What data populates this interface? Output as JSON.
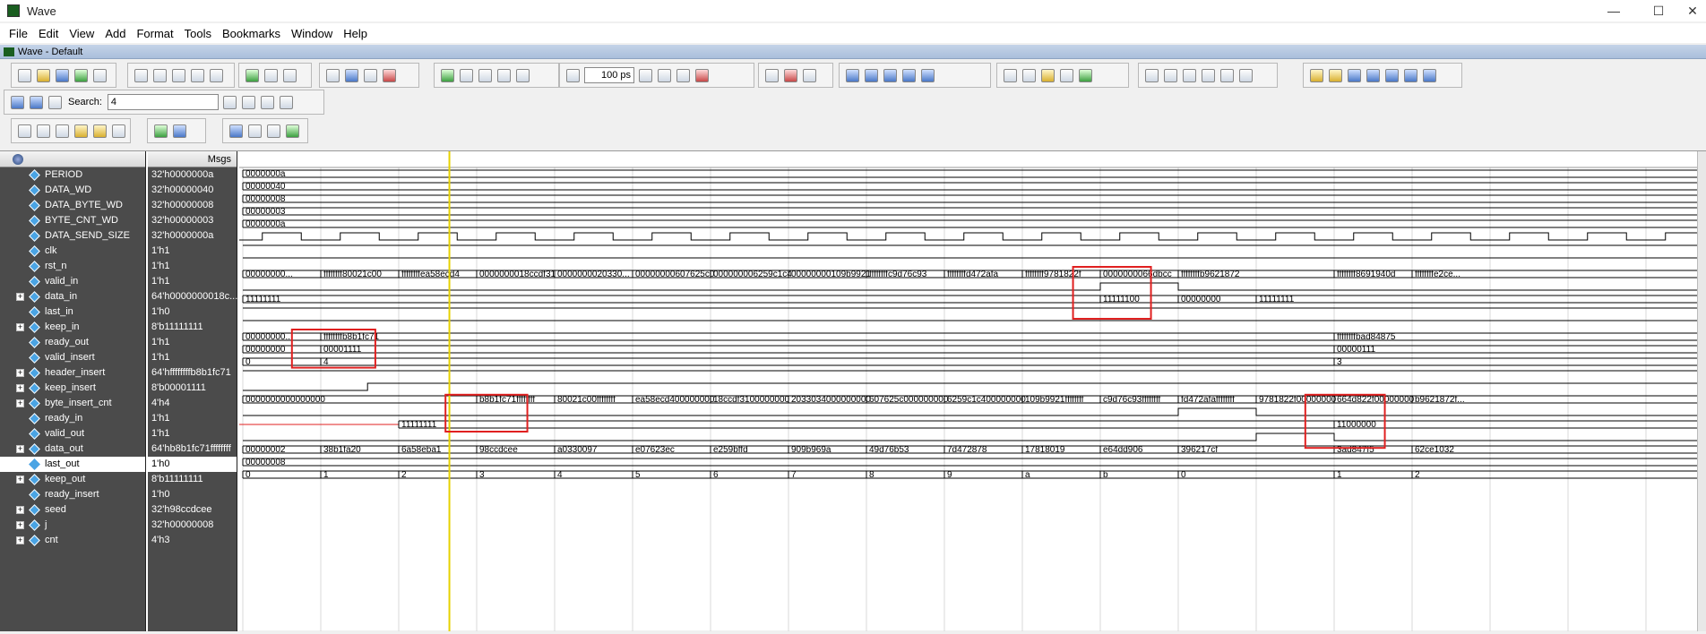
{
  "window": {
    "title": "Wave",
    "subtitle": "Wave - Default"
  },
  "menu": [
    "File",
    "Edit",
    "View",
    "Add",
    "Format",
    "Tools",
    "Bookmarks",
    "Window",
    "Help"
  ],
  "toolbar": {
    "search_label": "Search:",
    "search_value": "4",
    "time_value": "100 ps"
  },
  "header": {
    "msgs": "Msgs"
  },
  "signals": [
    {
      "name": "PERIOD",
      "value": "32'h0000000a",
      "exp": false
    },
    {
      "name": "DATA_WD",
      "value": "32'h00000040",
      "exp": false
    },
    {
      "name": "DATA_BYTE_WD",
      "value": "32'h00000008",
      "exp": false
    },
    {
      "name": "BYTE_CNT_WD",
      "value": "32'h00000003",
      "exp": false
    },
    {
      "name": "DATA_SEND_SIZE",
      "value": "32'h0000000a",
      "exp": false
    },
    {
      "name": "clk",
      "value": "1'h1",
      "exp": false
    },
    {
      "name": "rst_n",
      "value": "1'h1",
      "exp": false
    },
    {
      "name": "valid_in",
      "value": "1'h1",
      "exp": false
    },
    {
      "name": "data_in",
      "value": "64'h0000000018c...",
      "exp": true
    },
    {
      "name": "last_in",
      "value": "1'h0",
      "exp": false
    },
    {
      "name": "keep_in",
      "value": "8'b11111111",
      "exp": true
    },
    {
      "name": "ready_out",
      "value": "1'h1",
      "exp": false
    },
    {
      "name": "valid_insert",
      "value": "1'h1",
      "exp": false
    },
    {
      "name": "header_insert",
      "value": "64'hffffffffb8b1fc71",
      "exp": true
    },
    {
      "name": "keep_insert",
      "value": "8'b00001111",
      "exp": true
    },
    {
      "name": "byte_insert_cnt",
      "value": "4'h4",
      "exp": true
    },
    {
      "name": "ready_in",
      "value": "1'h1",
      "exp": false
    },
    {
      "name": "valid_out",
      "value": "1'h1",
      "exp": false
    },
    {
      "name": "data_out",
      "value": "64'hb8b1fc71ffffffff",
      "exp": true
    },
    {
      "name": "last_out",
      "value": "1'h0",
      "exp": false,
      "selected": true
    },
    {
      "name": "keep_out",
      "value": "8'b11111111",
      "exp": true
    },
    {
      "name": "ready_insert",
      "value": "1'h0",
      "exp": false
    },
    {
      "name": "seed",
      "value": "32'h98ccdcee",
      "exp": true
    },
    {
      "name": "j",
      "value": "32'h00000008",
      "exp": true
    },
    {
      "name": "cnt",
      "value": "4'h3",
      "exp": true
    }
  ],
  "waves": {
    "PERIOD": [
      [
        0,
        "0000000a"
      ]
    ],
    "DATA_WD": [
      [
        0,
        "00000040"
      ]
    ],
    "DATA_BYTE_WD": [
      [
        0,
        "00000008"
      ]
    ],
    "BYTE_CNT_WD": [
      [
        0,
        "00000003"
      ]
    ],
    "DATA_SEND_SIZE": [
      [
        0,
        "0000000a"
      ]
    ],
    "data_in": [
      [
        0,
        "00000000..."
      ],
      [
        1,
        "ffffffff80021c00"
      ],
      [
        2,
        "ffffffffea58ecd4"
      ],
      [
        3,
        "0000000018ccdf31"
      ],
      [
        4,
        "0000000020330..."
      ],
      [
        5,
        "00000000607625c0"
      ],
      [
        6,
        "000000006259c1c4"
      ],
      [
        7,
        "00000000109b9921"
      ],
      [
        8,
        "ffffffffc9d76c93"
      ],
      [
        9,
        "ffffffffd472afa"
      ],
      [
        10,
        "ffffffff9781822f"
      ],
      [
        11,
        "0000000066dbcc"
      ],
      [
        12,
        "ffffffffb9621872"
      ],
      [
        14,
        "ffffffff8691940d"
      ],
      [
        15,
        "ffffffffe2ce..."
      ]
    ],
    "keep_in": [
      [
        0,
        "11111111"
      ],
      [
        11,
        "11111100"
      ],
      [
        12,
        "00000000"
      ],
      [
        13,
        "11111111"
      ]
    ],
    "header_insert": [
      [
        0,
        "00000000..."
      ],
      [
        1,
        "ffffffffb8b1fc71"
      ],
      [
        14,
        "ffffffffbad84875"
      ]
    ],
    "keep_insert": [
      [
        0,
        "00000000"
      ],
      [
        1,
        "00001111"
      ],
      [
        14,
        "00000111"
      ]
    ],
    "byte_insert_cnt": [
      [
        0,
        "0"
      ],
      [
        1,
        "4"
      ],
      [
        14,
        "3"
      ]
    ],
    "data_out": [
      [
        0,
        "0000000000000000"
      ],
      [
        3,
        "b8b1fc71ffffffff"
      ],
      [
        4,
        "80021c00ffffffff"
      ],
      [
        5,
        "ea58ecd400000000"
      ],
      [
        6,
        "18ccdf3100000000"
      ],
      [
        7,
        "2033034000000000"
      ],
      [
        8,
        "607625c000000000"
      ],
      [
        9,
        "6259c1c400000000"
      ],
      [
        10,
        "109b9921ffffffff"
      ],
      [
        11,
        "c9d76c93ffffffff"
      ],
      [
        12,
        "fd472afaffffffff"
      ],
      [
        13,
        "9781822f00000000"
      ],
      [
        14,
        "664d822f00000000"
      ],
      [
        15,
        "b9621872f..."
      ]
    ],
    "keep_out": [
      [
        0,
        ""
      ],
      [
        2,
        "11111111"
      ],
      [
        14,
        "11000000"
      ]
    ],
    "seed": [
      [
        0,
        "00000002"
      ],
      [
        1,
        "38b1fa20"
      ],
      [
        2,
        "6a58eba1"
      ],
      [
        3,
        "98ccdcee"
      ],
      [
        4,
        "a0330097"
      ],
      [
        5,
        "e07623ec"
      ],
      [
        6,
        "e259bffd"
      ],
      [
        7,
        "909b969a"
      ],
      [
        8,
        "49d76b53"
      ],
      [
        9,
        "7d472878"
      ],
      [
        10,
        "17818019"
      ],
      [
        11,
        "e64dd906"
      ],
      [
        12,
        "396217cf"
      ],
      [
        14,
        "3ad847f5"
      ],
      [
        15,
        "62ce1032"
      ]
    ],
    "j": [
      [
        0,
        "00000008"
      ]
    ],
    "cnt": [
      [
        0,
        "0"
      ],
      [
        1,
        "1"
      ],
      [
        2,
        "2"
      ],
      [
        3,
        "3"
      ],
      [
        4,
        "4"
      ],
      [
        5,
        "5"
      ],
      [
        6,
        "6"
      ],
      [
        7,
        "7"
      ],
      [
        8,
        "8"
      ],
      [
        9,
        "9"
      ],
      [
        10,
        "a"
      ],
      [
        11,
        "b"
      ],
      [
        12,
        "0"
      ],
      [
        14,
        "1"
      ],
      [
        15,
        "2"
      ]
    ]
  },
  "digital": {
    "clk": "clock",
    "rst_n": [
      [
        0,
        1
      ]
    ],
    "valid_in": [
      [
        0,
        1
      ]
    ],
    "last_in": [
      [
        0,
        0
      ],
      [
        11,
        1
      ],
      [
        12,
        0
      ]
    ],
    "ready_out": [
      [
        0,
        1
      ]
    ],
    "valid_insert": [
      [
        0,
        1
      ]
    ],
    "ready_in": [
      [
        0,
        1
      ]
    ],
    "valid_out": [
      [
        0,
        0
      ],
      [
        1.6,
        1
      ]
    ],
    "last_out": [
      [
        0,
        0
      ],
      [
        12,
        1
      ],
      [
        13,
        0
      ]
    ],
    "ready_insert": [
      [
        0,
        0
      ],
      [
        13,
        1
      ],
      [
        14,
        0
      ]
    ]
  },
  "colors": {
    "cursor": "#e6d200",
    "highlight": "#e02020",
    "wave": "#000000",
    "bg": "#ffffff"
  }
}
